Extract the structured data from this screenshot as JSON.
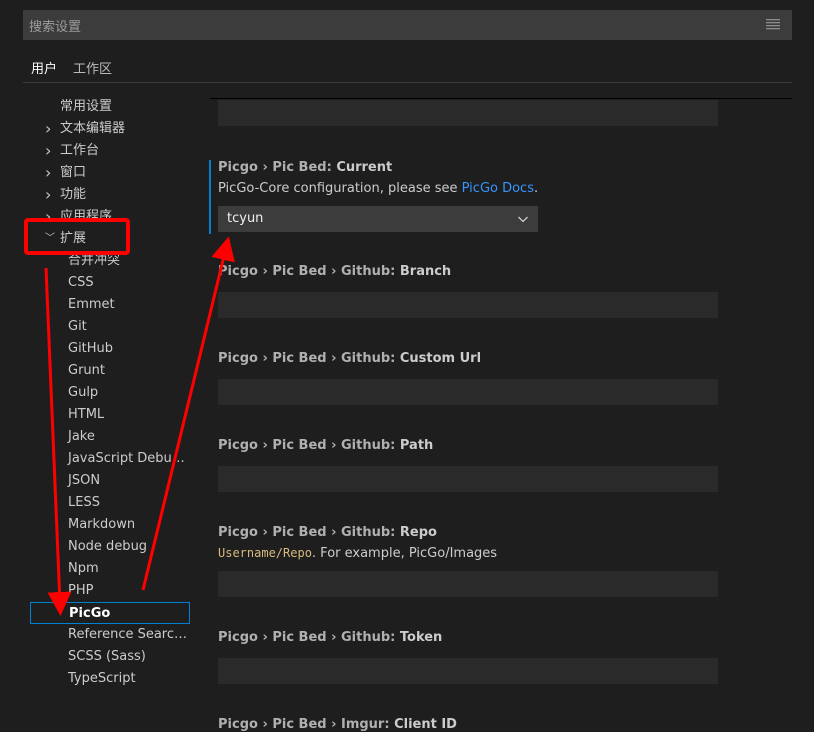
{
  "search": {
    "placeholder": "搜索设置"
  },
  "tabs": [
    {
      "label": "用户"
    },
    {
      "label": "工作区"
    }
  ],
  "toc": [
    {
      "label": "常用设置",
      "level": 0,
      "chevron": ""
    },
    {
      "label": "文本编辑器",
      "level": 0,
      "chevron": "right"
    },
    {
      "label": "工作台",
      "level": 0,
      "chevron": "right"
    },
    {
      "label": "窗口",
      "level": 0,
      "chevron": "right"
    },
    {
      "label": "功能",
      "level": 0,
      "chevron": "right"
    },
    {
      "label": "应用程序",
      "level": 0,
      "chevron": "right"
    },
    {
      "label": "扩展",
      "level": 0,
      "chevron": "down"
    },
    {
      "label": "合并冲突",
      "level": 1
    },
    {
      "label": "CSS",
      "level": 1
    },
    {
      "label": "Emmet",
      "level": 1
    },
    {
      "label": "Git",
      "level": 1
    },
    {
      "label": "GitHub",
      "level": 1
    },
    {
      "label": "Grunt",
      "level": 1
    },
    {
      "label": "Gulp",
      "level": 1
    },
    {
      "label": "HTML",
      "level": 1
    },
    {
      "label": "Jake",
      "level": 1
    },
    {
      "label": "JavaScript Debugger",
      "level": 1
    },
    {
      "label": "JSON",
      "level": 1
    },
    {
      "label": "LESS",
      "level": 1
    },
    {
      "label": "Markdown",
      "level": 1
    },
    {
      "label": "Node debug",
      "level": 1
    },
    {
      "label": "Npm",
      "level": 1
    },
    {
      "label": "PHP",
      "level": 1
    },
    {
      "label": "PicGo",
      "level": 1,
      "selected": true
    },
    {
      "label": "Reference Search V...",
      "level": 1
    },
    {
      "label": "SCSS (Sass)",
      "level": 1
    },
    {
      "label": "TypeScript",
      "level": 1
    }
  ],
  "settings": {
    "current": {
      "category": "Picgo › Pic Bed: ",
      "name": "Current",
      "desc_prefix": "PicGo-Core configuration, please see ",
      "desc_link": "PicGo Docs",
      "desc_suffix": ".",
      "value": "tcyun"
    },
    "branch": {
      "category": "Picgo › Pic Bed › Github: ",
      "name": "Branch"
    },
    "custom_url": {
      "category": "Picgo › Pic Bed › Github: ",
      "name": "Custom Url"
    },
    "path": {
      "category": "Picgo › Pic Bed › Github: ",
      "name": "Path"
    },
    "repo": {
      "category": "Picgo › Pic Bed › Github: ",
      "name": "Repo",
      "desc_code": "Username/Repo",
      "desc_text": ". For example, PicGo/Images"
    },
    "token": {
      "category": "Picgo › Pic Bed › Github: ",
      "name": "Token"
    },
    "client_id": {
      "category": "Picgo › Pic Bed › Imgur: ",
      "name": "Client ID"
    }
  },
  "colors": {
    "accent": "#007fd4",
    "link": "#3794ff",
    "annotation": "#ff0000"
  }
}
